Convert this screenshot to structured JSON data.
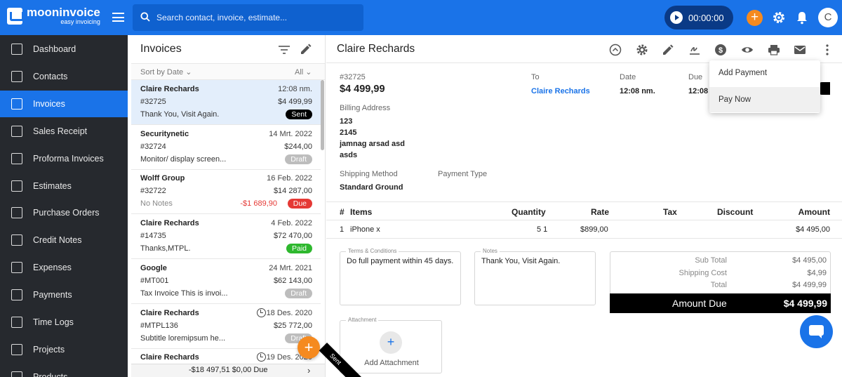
{
  "app": {
    "brand": "mooninvoice",
    "tagline": "easy invoicing",
    "accent": "#1a73e8"
  },
  "search": {
    "placeholder": "Search contact, invoice, estimate..."
  },
  "timer": {
    "value": "00:00:00"
  },
  "user": {
    "initial": "C"
  },
  "sidebar": {
    "items": [
      {
        "label": "Dashboard",
        "icon": "dashboard-icon"
      },
      {
        "label": "Contacts",
        "icon": "contacts-icon"
      },
      {
        "label": "Invoices",
        "icon": "invoice-icon",
        "active": true
      },
      {
        "label": "Sales Receipt",
        "icon": "receipt-icon"
      },
      {
        "label": "Proforma Invoices",
        "icon": "proforma-icon"
      },
      {
        "label": "Estimates",
        "icon": "estimate-icon"
      },
      {
        "label": "Purchase Orders",
        "icon": "cart-icon"
      },
      {
        "label": "Credit Notes",
        "icon": "credit-note-icon"
      },
      {
        "label": "Expenses",
        "icon": "wallet-icon"
      },
      {
        "label": "Payments",
        "icon": "payments-icon"
      },
      {
        "label": "Time Logs",
        "icon": "clock-icon"
      },
      {
        "label": "Projects",
        "icon": "folder-icon"
      },
      {
        "label": "Products",
        "icon": "box-icon"
      }
    ]
  },
  "list": {
    "title": "Invoices",
    "sort_label": "Sort by Date",
    "filter_value": "All",
    "rows": [
      {
        "name": "Claire Rechards",
        "date": "12:08 nm.",
        "number": "#32725",
        "amount": "$4 499,99",
        "note": "Thank You, Visit Again.",
        "status": "Sent",
        "status_color": "#000000"
      },
      {
        "name": "Securitynetic",
        "date": "14 Mrt. 2022",
        "number": "#32724",
        "amount": "$244,00",
        "note": "Monitor/ display screen...",
        "status": "Draft",
        "status_color": "#bdbdbd"
      },
      {
        "name": "Wolff Group",
        "date": "16 Feb. 2022",
        "number": "#32722",
        "amount": "$14 287,00",
        "note": "No Notes",
        "overdue": "-$1 689,90",
        "status": "Due",
        "status_color": "#e53935"
      },
      {
        "name": "Claire Rechards",
        "date": "4 Feb. 2022",
        "number": "#14735",
        "amount": "$72 470,00",
        "note": "Thanks,MTPL.",
        "status": "Paid",
        "status_color": "#2eb82e"
      },
      {
        "name": "Google",
        "date": "24 Mrt. 2021",
        "number": "#MT001",
        "amount": "$62 143,00",
        "note": "Tax Invoice This is invoi...",
        "status": "Draft",
        "status_color": "#bdbdbd"
      },
      {
        "name": "Claire Rechards",
        "date": "18 Des. 2020",
        "number": "#MTPL136",
        "amount": "$25 772,00",
        "note": "Subtitle loremipsum he...",
        "status": "Draft",
        "status_color": "#bdbdbd"
      },
      {
        "name": "Claire Rechards",
        "date": "19 Des. 2020",
        "number": "",
        "amount": "",
        "note": "",
        "status": "",
        "status_color": ""
      }
    ],
    "footer": "-$18 497,51  $0,00  Due"
  },
  "detail": {
    "title": "Claire Rechards",
    "invoice_number": "#32725",
    "invoice_amount": "$4 499,99",
    "to_label": "To",
    "to_name": "Claire Rechards",
    "date_label": "Date",
    "date_value": "12:08 nm.",
    "due_label": "Due",
    "due_value": "12:08",
    "billing_label": "Billing Address",
    "billing_lines": [
      "123",
      "2145",
      "jamnag arsad asd",
      "asds"
    ],
    "shipping_label": "Shipping Method",
    "shipping_value": "Standard Ground",
    "payment_type_label": "Payment Type",
    "table_headers": {
      "num": "#",
      "items": "Items",
      "quantity": "Quantity",
      "rate": "Rate",
      "tax": "Tax",
      "discount": "Discount",
      "amount": "Amount"
    },
    "items": [
      {
        "num": "1",
        "name": "iPhone x",
        "quantity": "5 1",
        "rate": "$899,00",
        "tax": "",
        "discount": "",
        "amount": "$4 495,00"
      }
    ],
    "terms_label": "Terms & Conditions",
    "terms": "Do full payment within 45 days.",
    "notes_label": "Notes",
    "notes": "Thank You, Visit Again.",
    "subtotal_label": "Sub Total",
    "subtotal": "$4 495,00",
    "shipping_cost_label": "Shipping Cost",
    "shipping_cost": "$4,99",
    "total_label": "Total",
    "total": "$4 499,99",
    "amount_due_label": "Amount Due",
    "amount_due": "$4 499,99",
    "attachment_label": "Attachment",
    "add_attachment": "Add Attachment",
    "ribbon": "Sent"
  },
  "dropdown": {
    "items": [
      "Add Payment",
      "Pay Now"
    ]
  }
}
